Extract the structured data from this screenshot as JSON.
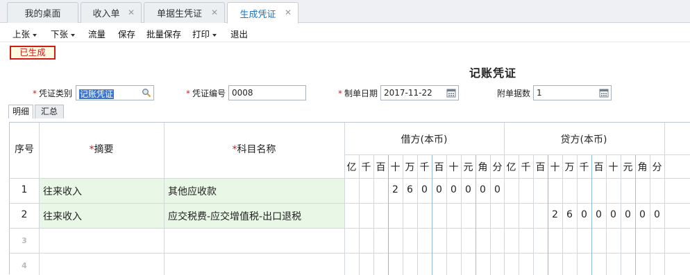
{
  "tabs": [
    {
      "label": "我的桌面",
      "closable": false
    },
    {
      "label": "收入单",
      "closable": true
    },
    {
      "label": "单据生凭证",
      "closable": true
    },
    {
      "label": "生成凭证",
      "closable": true,
      "active": true
    }
  ],
  "toolbar": {
    "prev": "上张",
    "next": "下张",
    "flow": "流量",
    "save": "保存",
    "batch_save": "批量保存",
    "print": "打印",
    "exit": "退出"
  },
  "status_badge": "已生成",
  "doc_title": "记账凭证",
  "form": {
    "voucher_type_label": "凭证类别",
    "voucher_type_value": "记账凭证",
    "voucher_no_label": "凭证编号",
    "voucher_no_value": "0008",
    "date_label": "制单日期",
    "date_value": "2017-11-22",
    "attach_label": "附单据数",
    "attach_value": "1"
  },
  "subtabs": [
    "明细",
    "汇总"
  ],
  "table": {
    "col_seq": "序号",
    "col_summary": "摘要",
    "col_account": "科目名称",
    "debit_header": "借方(本币)",
    "credit_header": "贷方(本币)",
    "digit_units": [
      "亿",
      "千",
      "百",
      "十",
      "万",
      "千",
      "百",
      "十",
      "元",
      "角",
      "分"
    ],
    "rows": [
      {
        "seq": "1",
        "summary": "往来收入",
        "account": "其他应收款",
        "debit_digits": [
          "",
          "",
          "",
          "2",
          "6",
          "0",
          "0",
          "0",
          "0",
          "0",
          "0"
        ],
        "credit_digits": [
          "",
          "",
          "",
          "",
          "",
          "",
          "",
          "",
          "",
          "",
          ""
        ]
      },
      {
        "seq": "2",
        "summary": "往来收入",
        "account": "应交税费-应交增值税-出口退税",
        "debit_digits": [
          "",
          "",
          "",
          "",
          "",
          "",
          "",
          "",
          "",
          "",
          ""
        ],
        "credit_digits": [
          "",
          "",
          "",
          "2",
          "6",
          "0",
          "0",
          "0",
          "0",
          "0",
          "0"
        ]
      },
      {
        "seq": "3",
        "summary": "",
        "account": "",
        "debit_digits": [],
        "credit_digits": []
      },
      {
        "seq": "4",
        "summary": "",
        "account": "",
        "debit_digits": [],
        "credit_digits": []
      }
    ]
  }
}
